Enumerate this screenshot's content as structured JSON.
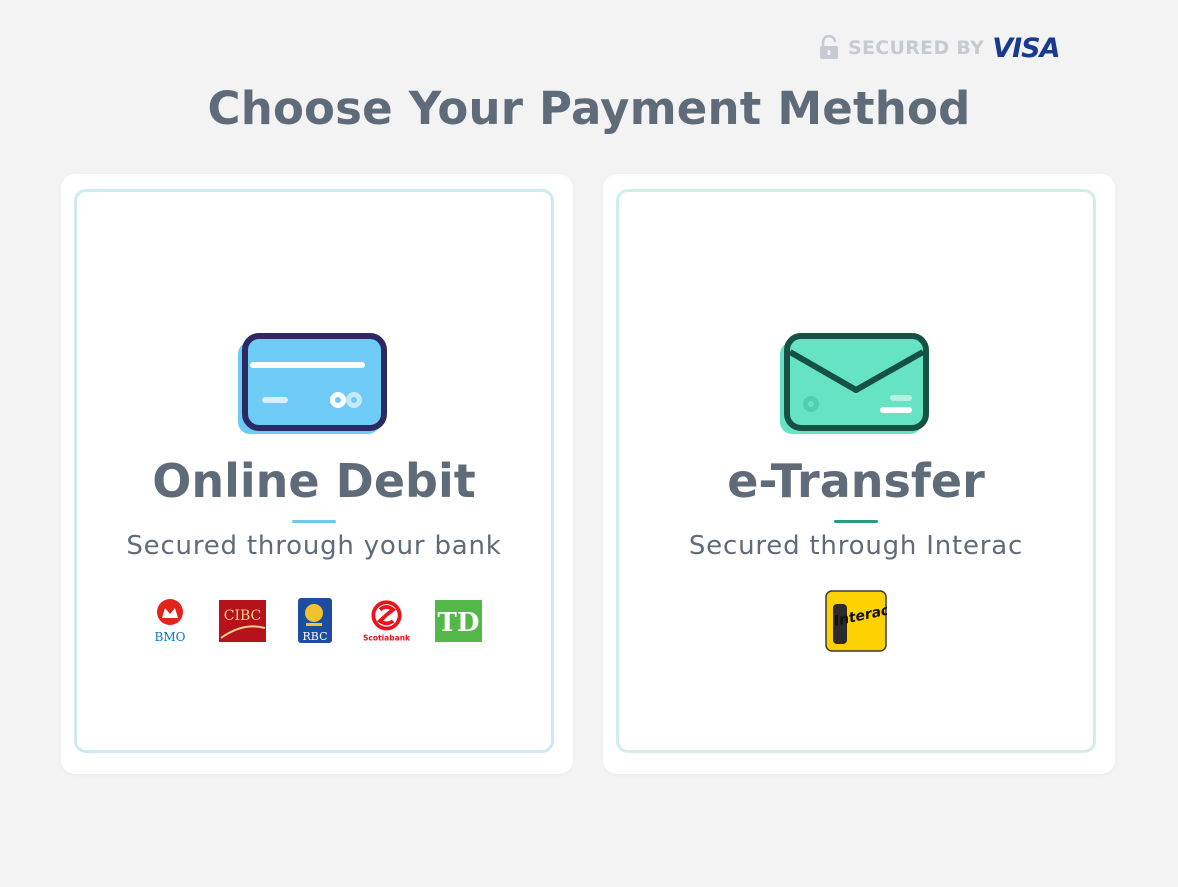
{
  "header": {
    "secured_label": "SECURED BY",
    "visa_label": "VISA",
    "title": "Choose Your Payment Method"
  },
  "methods": [
    {
      "title": "Online Debit",
      "subtitle": "Secured through your bank",
      "icon": "credit-card-icon",
      "accent": "#6ec8ea",
      "banks": [
        {
          "name": "BMO",
          "label": "BMO",
          "color": "#e2231a"
        },
        {
          "name": "CIBC",
          "label": "CIBC",
          "color": "#b5121b"
        },
        {
          "name": "RBC",
          "label": "RBC",
          "color": "#1c4da1"
        },
        {
          "name": "Scotiabank",
          "label": "Scotiabank",
          "color": "#ec111a"
        },
        {
          "name": "TD",
          "label": "TD",
          "color": "#54b848"
        }
      ]
    },
    {
      "title": "e-Transfer",
      "subtitle": "Secured through Interac",
      "icon": "envelope-icon",
      "accent": "#2a9a80",
      "provider": {
        "name": "Interac",
        "label": "Interac",
        "color": "#fdd000"
      }
    }
  ]
}
